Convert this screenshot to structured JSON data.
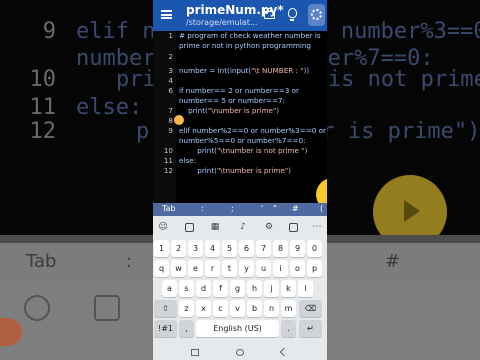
{
  "app": {
    "title": "primeNum.py*",
    "path": "/storage/emulat..."
  },
  "toolbar": {
    "icons": [
      "menu-icon",
      "folder-icon",
      "bulb-icon",
      "run-icon"
    ]
  },
  "code": [
    {
      "n": "1",
      "text": "# program of check weather number is"
    },
    {
      "n": "",
      "text": "prime or not in python programming"
    },
    {
      "n": "2",
      "text": ""
    },
    {
      "n": "3",
      "text": "number = int(input(\"\\t NUMBER : \"))"
    },
    {
      "n": "4",
      "text": ""
    },
    {
      "n": "6",
      "text": "if number== 2 or number==3 or"
    },
    {
      "n": "",
      "text": "number== 5 or number==7:"
    },
    {
      "n": "7",
      "text": "    print(\"\\number is prime\")"
    },
    {
      "n": "8",
      "text": ""
    },
    {
      "n": "9",
      "text": "elif number%2==0 or number%3==0 or"
    },
    {
      "n": "",
      "text": "number%5==0 or number%7==0:"
    },
    {
      "n": "10",
      "text": "        print(\"\\tnumber is not prime \")"
    },
    {
      "n": "11",
      "text": "else:"
    },
    {
      "n": "12",
      "text": "        print(\"\\tnumber is prime\")"
    }
  ],
  "background_code": [
    {
      "n": "9",
      "text": "elif number%2==0 or number%3==0 or"
    },
    {
      "n": "",
      "text": "number%5==0 or number%7==0:"
    },
    {
      "n": "10",
      "text": "print(\"\\tnumber is not prime \")"
    },
    {
      "n": "11",
      "text": "else:"
    },
    {
      "n": "12",
      "text": "print(\"\\tnumber is prime\")"
    }
  ],
  "symbol_bar": [
    "Tab",
    ":",
    ";",
    "'",
    "\"",
    "#",
    "("
  ],
  "keyboard": {
    "row_numbers": [
      "1",
      "2",
      "3",
      "4",
      "5",
      "6",
      "7",
      "8",
      "9",
      "0"
    ],
    "row1": [
      "q",
      "w",
      "e",
      "r",
      "t",
      "y",
      "u",
      "i",
      "o",
      "p"
    ],
    "row2": [
      "a",
      "s",
      "d",
      "f",
      "g",
      "h",
      "j",
      "k",
      "l"
    ],
    "row3": [
      "z",
      "x",
      "c",
      "v",
      "b",
      "n",
      "m"
    ],
    "shift": "⇧",
    "backspace": "⌫",
    "symbols": "!#1",
    "comma": ",",
    "space": "English (US)",
    "period": ".",
    "enter": "↵"
  },
  "colors": {
    "appbar": "#1b56b0",
    "code_text": "#a6ccff",
    "string": "#f1b7a8",
    "fab": "#f6c928"
  }
}
